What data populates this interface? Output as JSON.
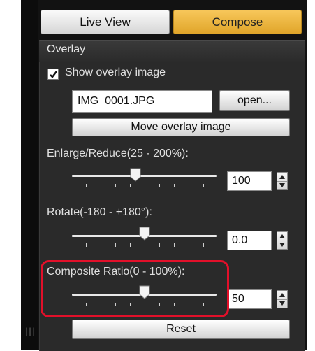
{
  "tabs": {
    "live_view": "Live View",
    "compose": "Compose"
  },
  "overlay": {
    "title": "Overlay",
    "show_overlay_label": "Show overlay image",
    "show_overlay_checked": true,
    "file_name": "IMG_0001.JPG",
    "open_button": "open...",
    "move_button": "Move overlay image",
    "enlarge": {
      "label": "Enlarge/Reduce(25 - 200%):",
      "value": "100"
    },
    "rotate": {
      "label": "Rotate(-180 - +180°):",
      "value": "0.0"
    },
    "composite": {
      "label": "Composite Ratio(0 - 100%):",
      "value": "50"
    },
    "reset_button": "Reset"
  },
  "colors": {
    "accent_tab": "#e9b23c",
    "highlight": "#e2102a"
  }
}
